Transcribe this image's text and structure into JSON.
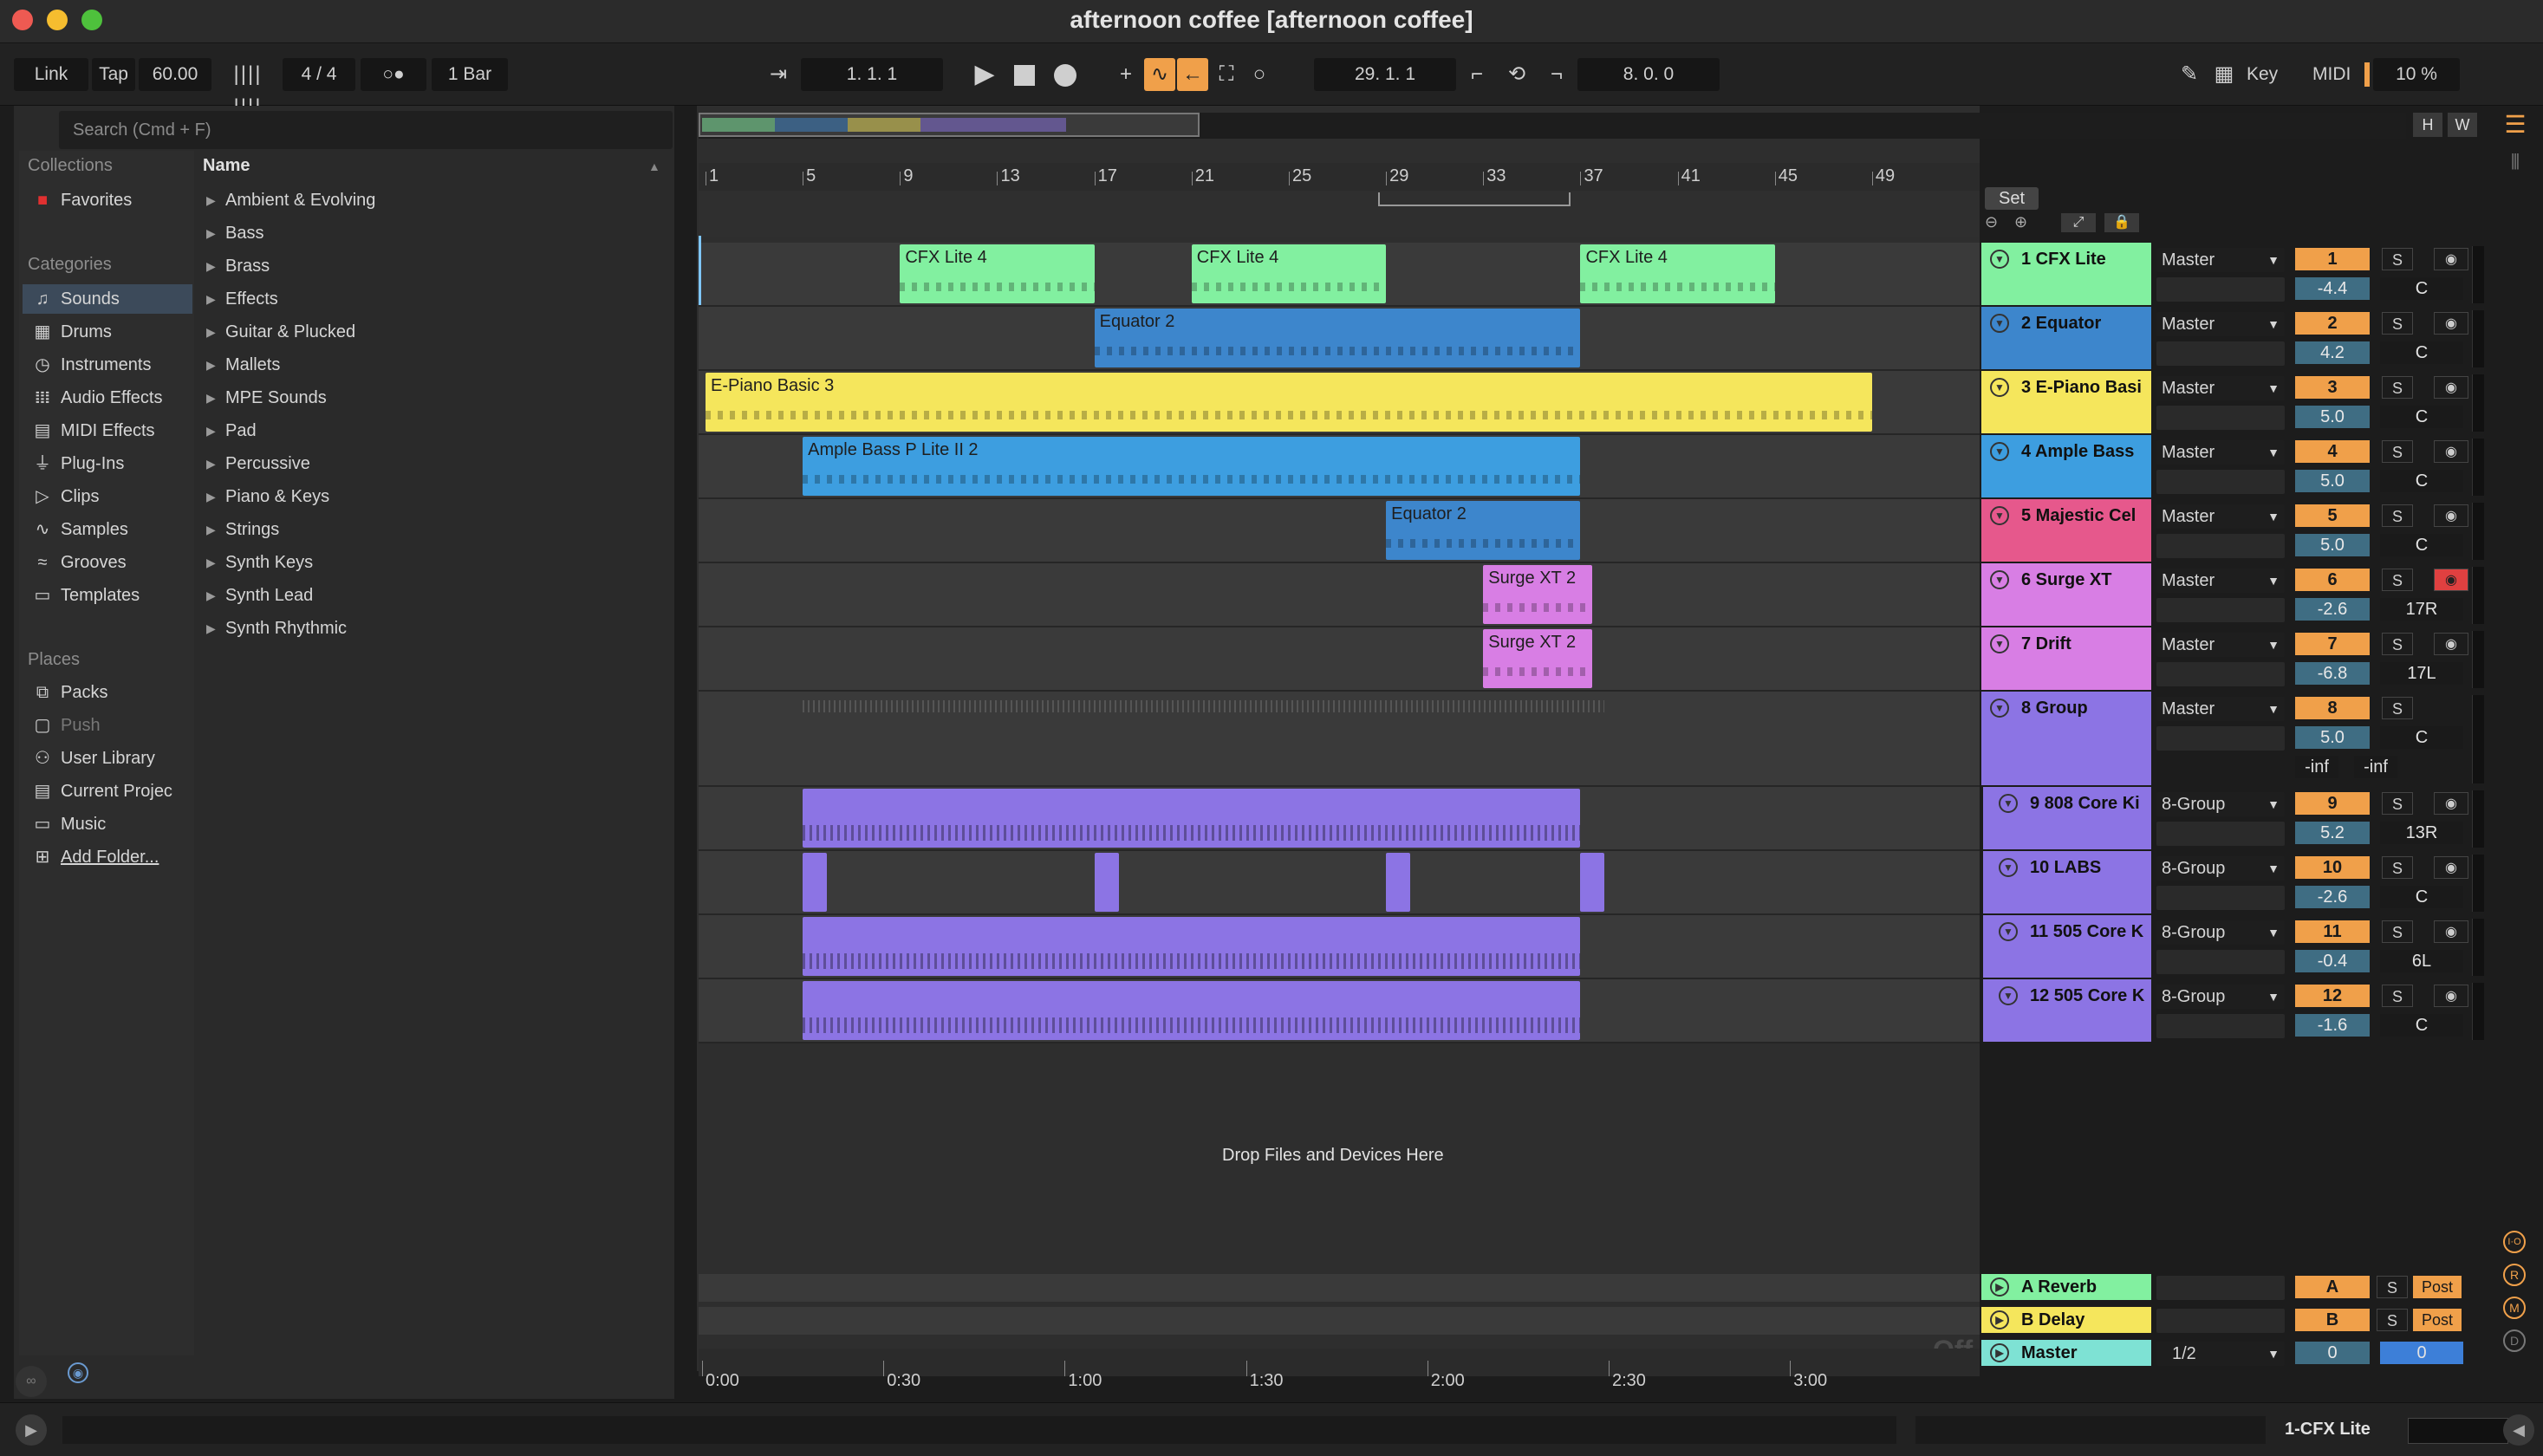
{
  "window": {
    "title": "afternoon coffee  [afternoon coffee]"
  },
  "control_bar": {
    "link": "Link",
    "tap": "Tap",
    "tempo": "60.00",
    "meter_icon": "metronome-bars-icon",
    "time_signature": "4 / 4",
    "metronome": "○●",
    "quantization": "1 Bar",
    "position": "1.   1.   1",
    "loop_start": "29.   1.   1",
    "loop_length": "8.   0.   0",
    "key": "Key",
    "midi": "MIDI",
    "cpu": "10 %"
  },
  "browser": {
    "search_placeholder": "Search (Cmd + F)",
    "collections_header": "Collections",
    "favorites": "Favorites",
    "categories_header": "Categories",
    "categories": [
      {
        "label": "Sounds",
        "icon": "note-icon"
      },
      {
        "label": "Drums",
        "icon": "grid-icon"
      },
      {
        "label": "Instruments",
        "icon": "clock-icon"
      },
      {
        "label": "Audio Effects",
        "icon": "waveform-icon"
      },
      {
        "label": "MIDI Effects",
        "icon": "midi-icon"
      },
      {
        "label": "Plug-Ins",
        "icon": "plug-icon"
      },
      {
        "label": "Clips",
        "icon": "clip-icon"
      },
      {
        "label": "Samples",
        "icon": "sample-icon"
      },
      {
        "label": "Grooves",
        "icon": "groove-icon"
      },
      {
        "label": "Templates",
        "icon": "template-icon"
      }
    ],
    "places_header": "Places",
    "places": [
      {
        "label": "Packs",
        "icon": "packs-icon"
      },
      {
        "label": "Push",
        "icon": "push-icon"
      },
      {
        "label": "User Library",
        "icon": "user-icon"
      },
      {
        "label": "Current Projec",
        "icon": "project-icon"
      },
      {
        "label": "Music",
        "icon": "folder-icon"
      },
      {
        "label": "Add Folder...",
        "icon": "add-folder-icon"
      }
    ],
    "name_header": "Name",
    "items": [
      "Ambient & Evolving",
      "Bass",
      "Brass",
      "Effects",
      "Guitar & Plucked",
      "Mallets",
      "MPE Sounds",
      "Pad",
      "Percussive",
      "Piano & Keys",
      "Strings",
      "Synth Keys",
      "Synth Lead",
      "Synth Rhythmic"
    ]
  },
  "arrangement": {
    "bars": [
      "1",
      "5",
      "9",
      "13",
      "17",
      "21",
      "25",
      "29",
      "33",
      "37",
      "41",
      "45",
      "49"
    ],
    "times": [
      "0:00",
      "0:30",
      "1:00",
      "1:30",
      "2:00",
      "2:30",
      "3:00"
    ],
    "set_label": "Set",
    "drop_text": "Drop Files and Devices Here",
    "off_label": "Off",
    "overview_h": "H",
    "overview_w": "W"
  },
  "clips": [
    {
      "name": "CFX Lite 4",
      "color": "#82f0a0"
    },
    {
      "name": "CFX Lite 4",
      "color": "#82f0a0"
    },
    {
      "name": "CFX Lite 4",
      "color": "#82f0a0"
    },
    {
      "name": "Equator 2",
      "color": "#3d86cc"
    },
    {
      "name": "E-Piano Basic 3",
      "color": "#f5e65c"
    },
    {
      "name": "Ample Bass P Lite II 2",
      "color": "#3d9ee0"
    },
    {
      "name": "Equator 2",
      "color": "#3d86cc"
    },
    {
      "name": "Surge XT 2",
      "color": "#d87ee4"
    },
    {
      "name": "Surge XT 2",
      "color": "#d87ee4"
    }
  ],
  "tracks": [
    {
      "name": "1 CFX Lite",
      "color": "#82f0a0",
      "io": "Master",
      "num": "1",
      "vol": "-4.4",
      "pan": "C"
    },
    {
      "name": "2 Equator",
      "color": "#3d86cc",
      "io": "Master",
      "num": "2",
      "vol": "4.2",
      "pan": "C"
    },
    {
      "name": "3 E-Piano Basi",
      "color": "#f5e65c",
      "io": "Master",
      "num": "3",
      "vol": "5.0",
      "pan": "C"
    },
    {
      "name": "4 Ample Bass",
      "color": "#3d9ee0",
      "io": "Master",
      "num": "4",
      "vol": "5.0",
      "pan": "C"
    },
    {
      "name": "5 Majestic Cel",
      "color": "#e6588c",
      "io": "Master",
      "num": "5",
      "vol": "5.0",
      "pan": "C"
    },
    {
      "name": "6 Surge XT",
      "color": "#d87ee4",
      "io": "Master",
      "num": "6",
      "vol": "-2.6",
      "pan": "17R"
    },
    {
      "name": "7 Drift",
      "color": "#d87ee4",
      "io": "Master",
      "num": "7",
      "vol": "-6.8",
      "pan": "17L"
    },
    {
      "name": "8 Group",
      "color": "#8c74e4",
      "io": "Master",
      "num": "8",
      "vol": "5.0",
      "pan": "C",
      "peak_l": "-inf",
      "peak_r": "-inf"
    },
    {
      "name": "9 808 Core Ki",
      "color": "#8c74e4",
      "io": "8-Group",
      "num": "9",
      "vol": "5.2",
      "pan": "13R"
    },
    {
      "name": "10 LABS",
      "color": "#8c74e4",
      "io": "8-Group",
      "num": "10",
      "vol": "-2.6",
      "pan": "C"
    },
    {
      "name": "11 505 Core K",
      "color": "#8c74e4",
      "io": "8-Group",
      "num": "11",
      "vol": "-0.4",
      "pan": "6L"
    },
    {
      "name": "12 505 Core K",
      "color": "#8c74e4",
      "io": "8-Group",
      "num": "12",
      "vol": "-1.6",
      "pan": "C"
    }
  ],
  "returns": [
    {
      "name": "A Reverb",
      "color": "#82f0a0",
      "num": "A",
      "post": "Post"
    },
    {
      "name": "B Delay",
      "color": "#f5e65c",
      "num": "B",
      "post": "Post"
    }
  ],
  "master": {
    "name": "Master",
    "color": "#7ee2d4",
    "io": "1/2",
    "vol": "0",
    "pan": "0"
  },
  "solo": "S",
  "statusbar": {
    "selected": "1-CFX Lite"
  }
}
